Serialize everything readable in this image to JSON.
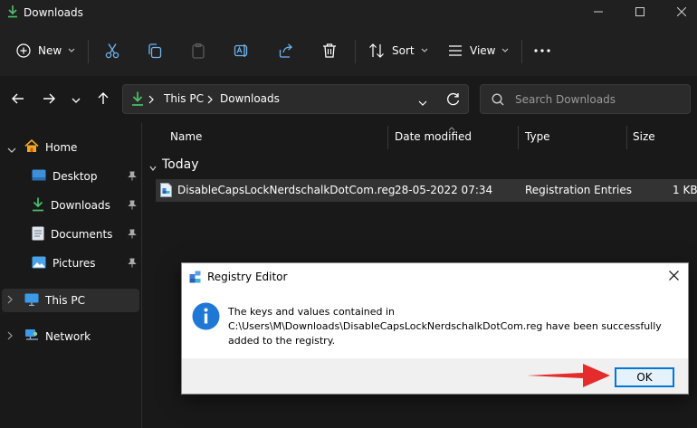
{
  "window": {
    "title": "Downloads",
    "minimize_icon": "minimize-icon",
    "maximize_icon": "maximize-icon",
    "close_icon": "close-icon"
  },
  "toolbar": {
    "new_label": "New",
    "sort_label": "Sort",
    "view_label": "View",
    "icons": [
      "plus-circle-icon",
      "cut-icon",
      "copy-icon",
      "paste-icon",
      "rename-icon",
      "share-icon",
      "delete-icon",
      "sort-icon",
      "view-icon",
      "more-icon"
    ]
  },
  "address": {
    "crumbs": [
      "This PC",
      "Downloads"
    ],
    "search_placeholder": "Search Downloads"
  },
  "sidebar": {
    "items": [
      {
        "label": "Home",
        "icon": "home-icon",
        "pinned": false
      },
      {
        "label": "Desktop",
        "icon": "desktop-icon",
        "pinned": true
      },
      {
        "label": "Downloads",
        "icon": "download-icon",
        "pinned": true
      },
      {
        "label": "Documents",
        "icon": "documents-icon",
        "pinned": true
      },
      {
        "label": "Pictures",
        "icon": "pictures-icon",
        "pinned": true
      },
      {
        "label": "This PC",
        "icon": "monitor-icon",
        "selected": true
      },
      {
        "label": "Network",
        "icon": "network-icon"
      }
    ]
  },
  "list": {
    "columns": [
      "Name",
      "Date modified",
      "Type",
      "Size"
    ],
    "group": "Today",
    "rows": [
      {
        "name": "DisableCapsLockNerdschalkDotCom.reg",
        "date": "28-05-2022 07:34",
        "type": "Registration Entries",
        "size": "1 KB"
      }
    ]
  },
  "dialog": {
    "title": "Registry Editor",
    "message_line1": "The keys and values contained in",
    "message_line2": "C:\\Users\\M\\Downloads\\DisableCapsLockNerdschalkDotCom.reg have been successfully",
    "message_line3": "added to the registry.",
    "ok_label": "OK",
    "icon": "info-icon"
  },
  "colors": {
    "accent": "#0078d7",
    "folder": "#f0c33c",
    "download_green": "#4cc26c",
    "annotation_arrow": "#e52b2b"
  }
}
